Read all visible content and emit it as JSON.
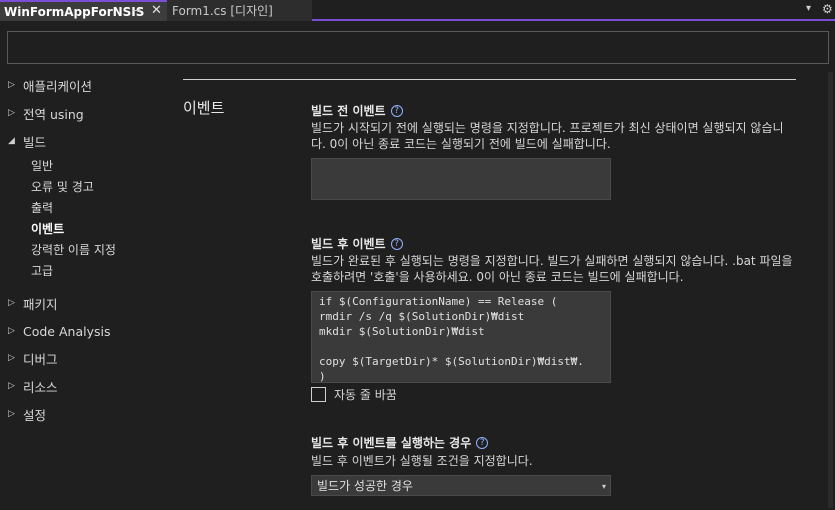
{
  "tabs": {
    "active_label": "WinFormAppForNSIS",
    "pin_glyph": "⊸",
    "close_glyph": "✕",
    "inactive_label": "Form1.cs [디자인]",
    "dropdown_glyph": "▾",
    "settings_glyph": "⚙"
  },
  "search": {
    "placeholder": "",
    "value": ""
  },
  "nav": {
    "items": [
      {
        "label": "애플리케이션",
        "arrow": "▷"
      },
      {
        "label": "전역 using",
        "arrow": "▷"
      },
      {
        "label": "빌드",
        "arrow": "◢"
      },
      {
        "label": "패키지",
        "arrow": "▷"
      },
      {
        "label": "Code Analysis",
        "arrow": "▷"
      },
      {
        "label": "디버그",
        "arrow": "▷"
      },
      {
        "label": "리소스",
        "arrow": "▷"
      },
      {
        "label": "설정",
        "arrow": "▷"
      }
    ],
    "build_subitems": [
      {
        "label": "일반"
      },
      {
        "label": "오류 및 경고"
      },
      {
        "label": "출력"
      },
      {
        "label": "이벤트"
      },
      {
        "label": "강력한 이름 지정"
      },
      {
        "label": "고급"
      }
    ],
    "selected": "이벤트"
  },
  "content": {
    "section_title": "이벤트",
    "help_glyph": "?",
    "pre_build": {
      "title": "빌드 전 이벤트",
      "description": "빌드가 시작되기 전에 실행되는 명령을 지정합니다. 프로젝트가 최신 상태이면 실행되지 않습니다. 0이 아닌 종료 코드는 실행되기 전에 빌드에 실패합니다.",
      "value": ""
    },
    "post_build": {
      "title": "빌드 후 이벤트",
      "description": "빌드가 완료된 후 실행되는 명령을 지정합니다. 빌드가 실패하면 실행되지 않습니다. .bat 파일을 호출하려면 '호출'을 사용하세요. 0이 아닌 종료 코드는 빌드에 실패합니다.",
      "value": "if $(ConfigurationName) == Release (\nrmdir /s /q $(SolutionDir)₩dist\nmkdir $(SolutionDir)₩dist\n\ncopy $(TargetDir)* $(SolutionDir)₩dist₩.\n)"
    },
    "word_wrap": {
      "label": "자동 줄 바꿈",
      "checked": false
    },
    "run_condition": {
      "title": "빌드 후 이벤트를 실행하는 경우",
      "description": "빌드 후 이벤트가 실행될 조건을 지정합니다.",
      "selected": "빌드가 성공한 경우",
      "caret_glyph": "▾"
    }
  },
  "colors": {
    "background": "#1f1f1f",
    "accent": "#7a4fd6",
    "input_bg": "#3a3a3a",
    "help_icon": "#8fb0ff"
  }
}
